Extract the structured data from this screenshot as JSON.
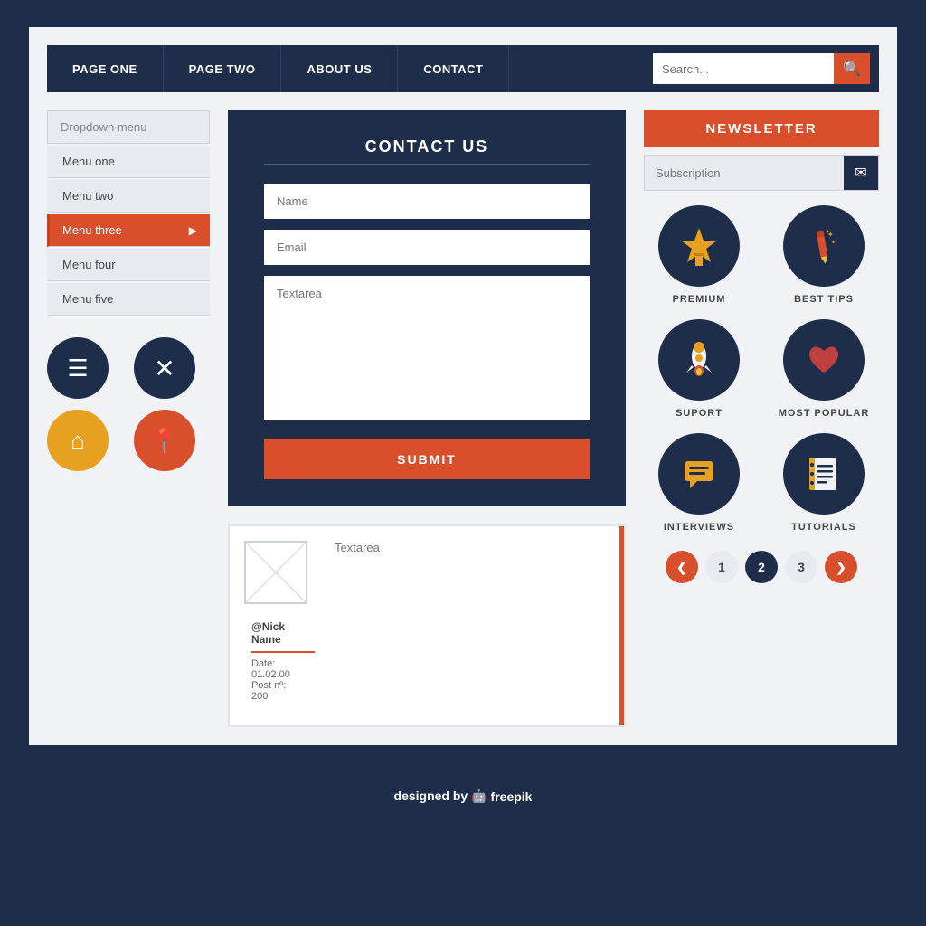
{
  "navbar": {
    "items": [
      {
        "label": "PAGE ONE",
        "id": "page-one"
      },
      {
        "label": "PAGE TWO",
        "id": "page-two"
      },
      {
        "label": "ABOUT US",
        "id": "about-us"
      },
      {
        "label": "CONTACT",
        "id": "contact"
      }
    ],
    "search_placeholder": "Search...",
    "search_icon": "🔍"
  },
  "sidebar": {
    "dropdown_label": "Dropdown menu",
    "items": [
      {
        "label": "Menu one",
        "active": false
      },
      {
        "label": "Menu two",
        "active": false
      },
      {
        "label": "Menu three",
        "active": true
      },
      {
        "label": "Menu four",
        "active": false
      },
      {
        "label": "Menu five",
        "active": false
      }
    ]
  },
  "contact_form": {
    "title": "CONTACT US",
    "name_placeholder": "Name",
    "email_placeholder": "Email",
    "textarea_placeholder": "Textarea",
    "submit_label": "SUBMIT"
  },
  "comment": {
    "textarea_placeholder": "Textarea",
    "nick": "@Nick Name",
    "date": "Date: 01.02.00",
    "post": "Post nº: 200"
  },
  "newsletter": {
    "title": "NEWSLETTER",
    "subscription_placeholder": "Subscription"
  },
  "categories": [
    {
      "label": "PREMIUM",
      "icon": "star"
    },
    {
      "label": "BEST TIPS",
      "icon": "pencil"
    },
    {
      "label": "SUPORT",
      "icon": "rocket"
    },
    {
      "label": "MOST POPULAR",
      "icon": "heart"
    },
    {
      "label": "INTERVIEWS",
      "icon": "chat"
    },
    {
      "label": "TUTORIALS",
      "icon": "notebook"
    }
  ],
  "pagination": {
    "prev": "❮",
    "next": "❯",
    "pages": [
      "1",
      "2",
      "3"
    ],
    "active_page": "2"
  },
  "footer": {
    "text": "designed by",
    "brand": "freepik"
  }
}
